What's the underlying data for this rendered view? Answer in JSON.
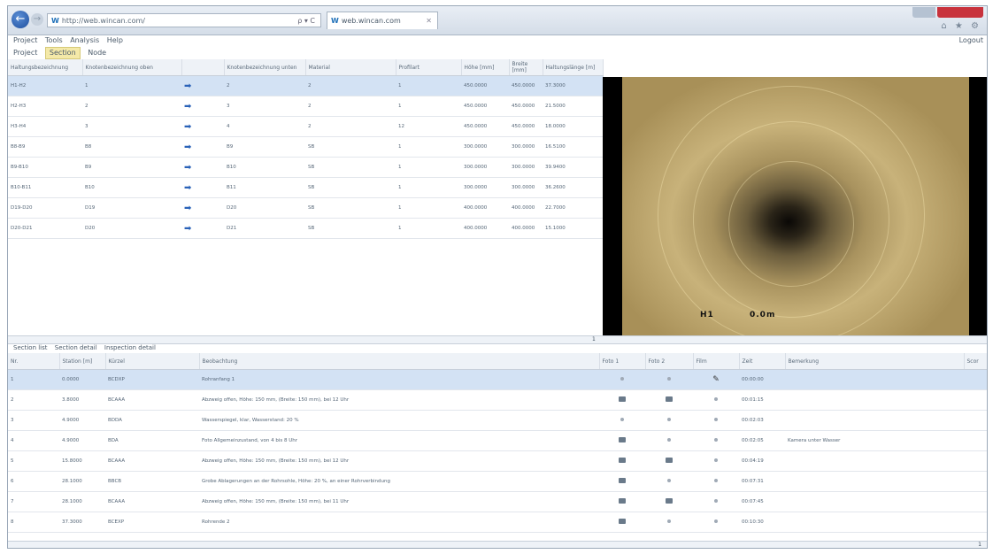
{
  "browser": {
    "url": "http://web.wincan.com/",
    "search_tools": "ρ ▾ C",
    "tab_title": "web.wincan.com",
    "tab_close": "✕",
    "back": "←",
    "forward": "→",
    "right_icons": "⌂ ★ ⚙"
  },
  "menu": {
    "items": [
      "Project",
      "Tools",
      "Analysis",
      "Help"
    ],
    "logout": "Logout"
  },
  "subtabs": [
    "Project",
    "Section",
    "Node"
  ],
  "subtabs_active": "Section",
  "sections": {
    "columns": [
      "Haltungsbezeichnung",
      "Knotenbezeichnung oben",
      "",
      "Knotenbezeichnung unten",
      "Material",
      "Profilart",
      "Höhe [mm]",
      "Breite [mm]",
      "Haltungslänge [m]"
    ],
    "rows": [
      [
        "H1-H2",
        "1",
        "2",
        "2",
        "1",
        "450.0000",
        "450.0000",
        "37.3000"
      ],
      [
        "H2-H3",
        "2",
        "3",
        "2",
        "1",
        "450.0000",
        "450.0000",
        "21.5000"
      ],
      [
        "H3-H4",
        "3",
        "4",
        "2",
        "12",
        "450.0000",
        "450.0000",
        "18.0000"
      ],
      [
        "B8-B9",
        "B8",
        "B9",
        "SB",
        "1",
        "300.0000",
        "300.0000",
        "16.5100"
      ],
      [
        "B9-B10",
        "B9",
        "B10",
        "SB",
        "1",
        "300.0000",
        "300.0000",
        "39.9400"
      ],
      [
        "B10-B11",
        "B10",
        "B11",
        "SB",
        "1",
        "300.0000",
        "300.0000",
        "36.2600"
      ],
      [
        "D19-D20",
        "D19",
        "D20",
        "SB",
        "1",
        "400.0000",
        "400.0000",
        "22.7000"
      ],
      [
        "D20-D21",
        "D20",
        "D21",
        "SB",
        "1",
        "400.0000",
        "400.0000",
        "15.1000"
      ]
    ],
    "page": "1"
  },
  "video": {
    "overlay_left": "H1",
    "overlay_right": "0.0m"
  },
  "lower_tabs": [
    "Section list",
    "Section detail",
    "Inspection detail"
  ],
  "inspections": {
    "columns": [
      "Nr.",
      "Station [m]",
      "Kürzel",
      "Beobachtung",
      "Foto 1",
      "Foto 2",
      "Film",
      "Zeit",
      "Bemerkung",
      "Scor"
    ],
    "rows": [
      {
        "nr": "1",
        "station": "0.0000",
        "code": "BCDXP",
        "obs": "Rohranfang 1",
        "f1": "dot",
        "f2": "dot",
        "film": "film",
        "time": "00:00:00",
        "note": ""
      },
      {
        "nr": "2",
        "station": "3.8000",
        "code": "BCAAA",
        "obs": "Abzweig offen, Höhe: 150 mm, (Breite: 150 mm), bei 12 Uhr",
        "f1": "photo",
        "f2": "photo",
        "film": "dot",
        "time": "00:01:15",
        "note": ""
      },
      {
        "nr": "3",
        "station": "4.9000",
        "code": "BDDA",
        "obs": "Wasserspiegel, klar, Wasserstand: 20 %",
        "f1": "dot",
        "f2": "dot",
        "film": "dot",
        "time": "00:02:03",
        "note": ""
      },
      {
        "nr": "4",
        "station": "4.9000",
        "code": "BDA",
        "obs": "Foto Allgemeinzustand, von 4 bis 8 Uhr",
        "f1": "photo",
        "f2": "dot",
        "film": "dot",
        "time": "00:02:05",
        "note": "Kamera unter Wasser"
      },
      {
        "nr": "5",
        "station": "15.8000",
        "code": "BCAAA",
        "obs": "Abzweig offen, Höhe: 150 mm, (Breite: 150 mm), bei 12 Uhr",
        "f1": "photo",
        "f2": "photo",
        "film": "dot",
        "time": "00:04:19",
        "note": ""
      },
      {
        "nr": "6",
        "station": "28.1000",
        "code": "BBCB",
        "obs": "Grobe Ablagerungen an der Rohrsohle, Höhe: 20 %, an einer Rohrverbindung",
        "f1": "photo",
        "f2": "dot",
        "film": "dot",
        "time": "00:07:31",
        "note": ""
      },
      {
        "nr": "7",
        "station": "28.1000",
        "code": "BCAAA",
        "obs": "Abzweig offen, Höhe: 150 mm, (Breite: 150 mm), bei 11 Uhr",
        "f1": "photo",
        "f2": "photo",
        "film": "dot",
        "time": "00:07:45",
        "note": ""
      },
      {
        "nr": "8",
        "station": "37.3000",
        "code": "BCEXP",
        "obs": "Rohrende 2",
        "f1": "photo",
        "f2": "dot",
        "film": "dot",
        "time": "00:10:30",
        "note": ""
      }
    ],
    "page": "1"
  }
}
